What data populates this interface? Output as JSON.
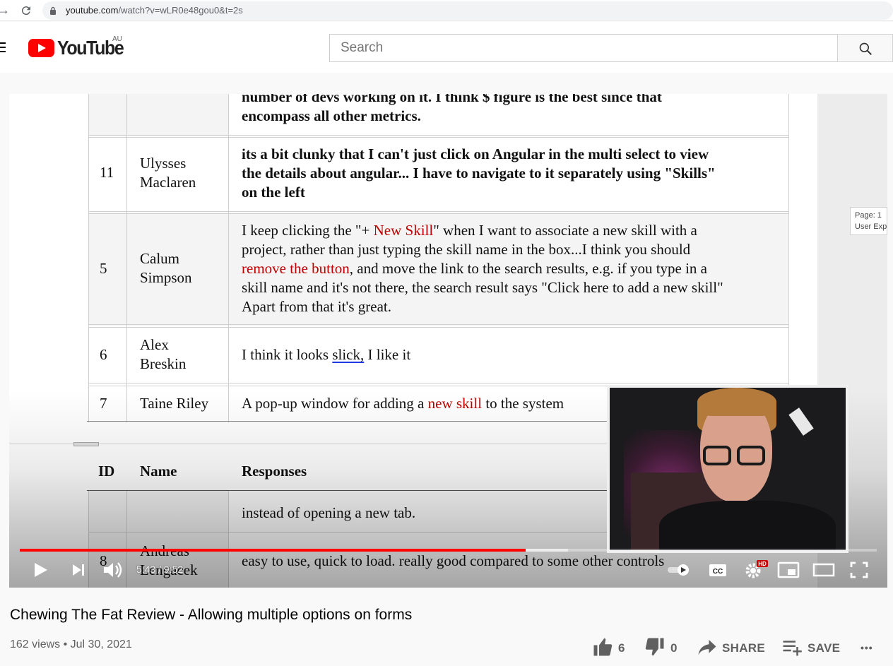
{
  "browser": {
    "url_host": "youtube.com",
    "url_path": "/watch?v=wLR0e48gou0&t=2s"
  },
  "header": {
    "logo_text": "YouTube",
    "region": "AU",
    "search_placeholder": "Search"
  },
  "document": {
    "top_text_line1": "number of devs working on it. I think $ figure is the best since that",
    "top_text_line2": "encompass all other metrics.",
    "rows": [
      {
        "id": "11",
        "name_line1": "Ulysses",
        "name_line2": "Maclaren",
        "response": [
          "its a bit clunky that I can't just click on Angular in the multi select to view",
          "the details about angular... I have to navigate to it separately using \"Skills\"",
          "on the left"
        ]
      },
      {
        "id": "5",
        "name_line1": "Calum",
        "name_line2": "Simpson",
        "response_a": "I keep clicking the \"+ ",
        "response_red1": "New Skill",
        "response_b": "\" when I want to associate a new skill with a",
        "response_line2": "project, rather than just typing the skill name in the box...I think you should",
        "response_red2": "remove the button",
        "response_line3": ", and move the link to the search results, e.g. if you type in a",
        "response_line4": "skill name and it's not there, the search result says \"Click here to add a new skill\"",
        "response_line5": "Apart from that it's great."
      },
      {
        "id": "6",
        "name_line1": "Alex",
        "name_line2": "Breskin",
        "response_a": "I think it looks ",
        "response_ul": "slick,",
        "response_b": " I like it"
      },
      {
        "id": "7",
        "name": "Taine Riley",
        "response_a": "A pop-up window for adding a ",
        "response_red": "new skill",
        "response_b": " to the system"
      }
    ],
    "header_id": "ID",
    "header_name": "Name",
    "header_responses": "Responses",
    "cont_response": "instead of opening a new tab.",
    "row8_id": "8",
    "row8_name_line1": "Andreas",
    "row8_name_line2": "Lengacek",
    "row8_response": "easy to use, quick to load. really good compared to some other controls",
    "page_tip_line1": "Page: 1",
    "page_tip_line2": "User Exp"
  },
  "player": {
    "time": "5:43 / 9:52",
    "progress_played": 0.59,
    "progress_buffered": 0.64,
    "hd_badge": "HD"
  },
  "video": {
    "title": "Chewing The Fat Review - Allowing multiple options on forms",
    "views": "162 views",
    "date": "Jul 30, 2021",
    "likes": "6",
    "dislikes": "0",
    "share_label": "SHARE",
    "save_label": "SAVE",
    "more_label": "•••"
  },
  "colors": {
    "brand_red": "#ff0000",
    "doc_red": "#c00000",
    "underline_blue": "#1f3ae0"
  }
}
